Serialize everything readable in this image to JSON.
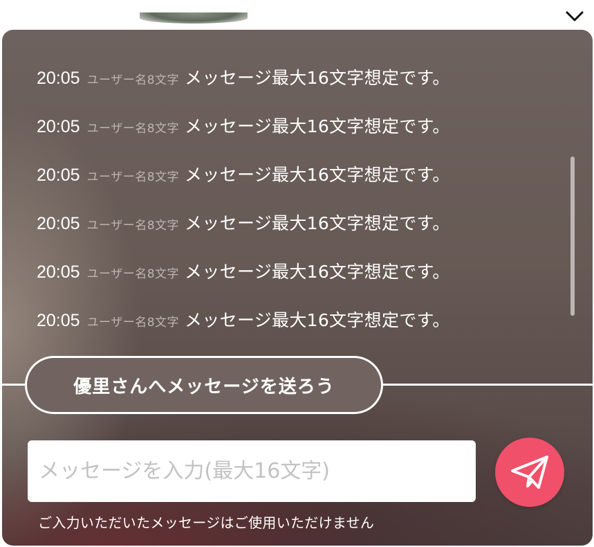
{
  "chat": {
    "messages": [
      {
        "time": "20:05",
        "user": "ユーザー名8文字",
        "text": "メッセージ最大16文字想定です。"
      },
      {
        "time": "20:05",
        "user": "ユーザー名8文字",
        "text": "メッセージ最大16文字想定です。"
      },
      {
        "time": "20:05",
        "user": "ユーザー名8文字",
        "text": "メッセージ最大16文字想定です。"
      },
      {
        "time": "20:05",
        "user": "ユーザー名8文字",
        "text": "メッセージ最大16文字想定です。"
      },
      {
        "time": "20:05",
        "user": "ユーザー名8文字",
        "text": "メッセージ最大16文字想定です。"
      },
      {
        "time": "20:05",
        "user": "ユーザー名8文字",
        "text": "メッセージ最大16文字想定です。"
      }
    ]
  },
  "compose": {
    "title": "優里さんへメッセージを送ろう",
    "input_value": "",
    "input_placeholder": "メッセージを入力(最大16文字)",
    "send_icon": "paper-plane-icon",
    "notice": "ご入力いただいたメッセージはご使用いただけません"
  },
  "header": {
    "toggle_icon": "chevron-down-icon"
  },
  "colors": {
    "send_button": "#f0506a",
    "panel_overlay": "#675a55",
    "username_text": "#bdb5b1"
  }
}
